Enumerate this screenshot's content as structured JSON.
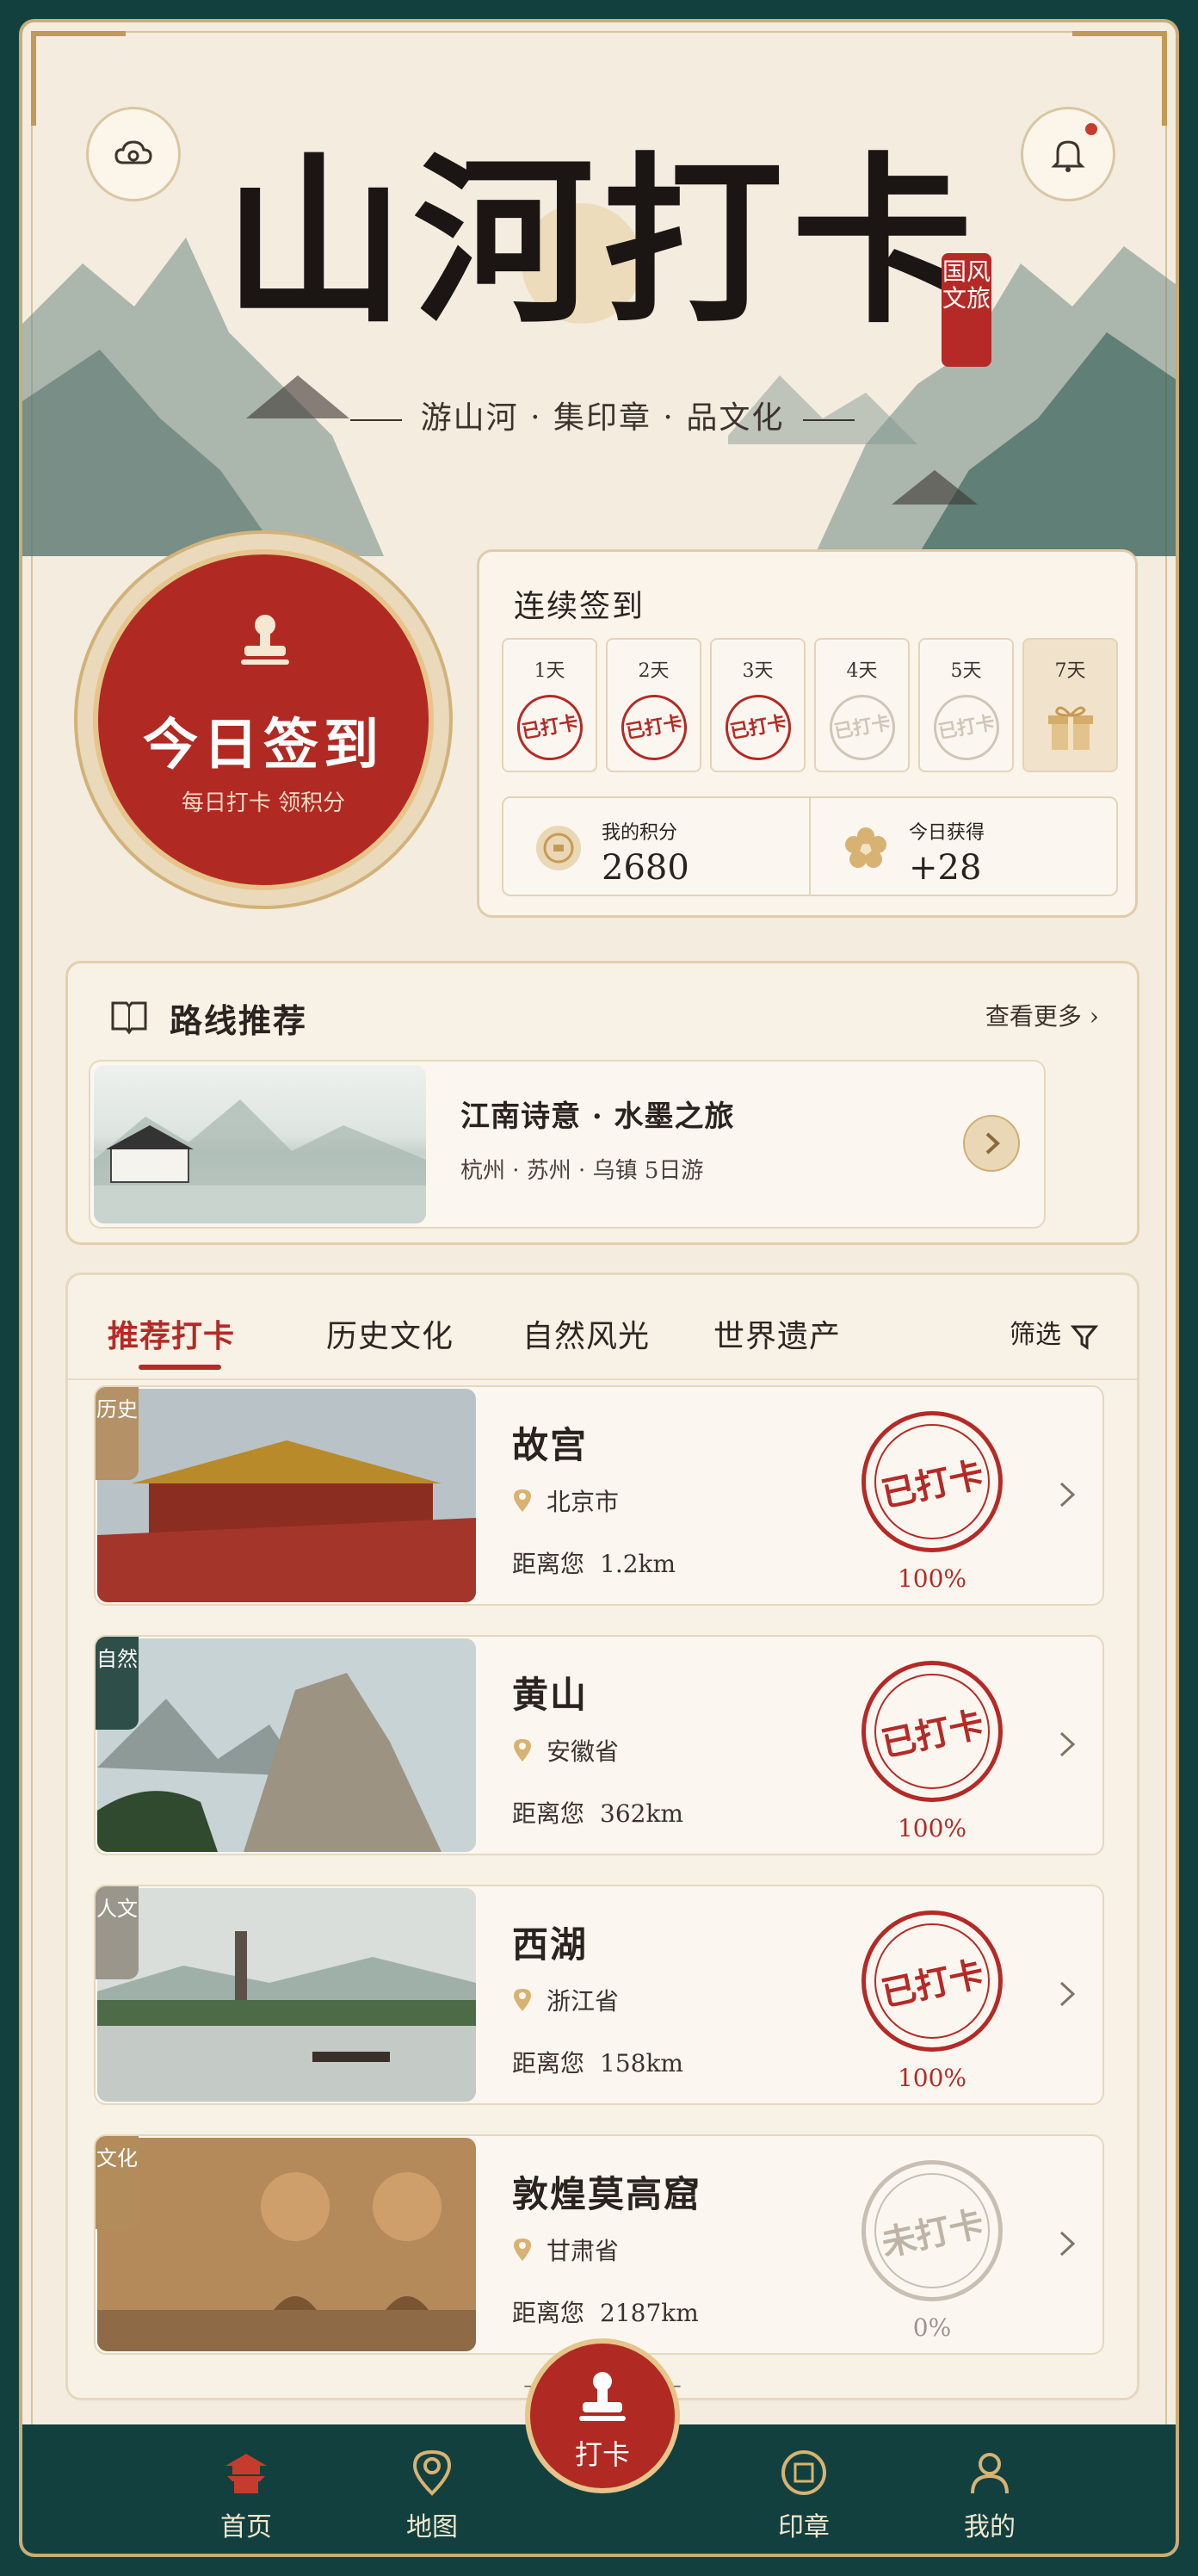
{
  "header": {
    "title": "山河打卡",
    "seal": "国风文旅",
    "subtitle": "游山河 · 集印章 · 品文化"
  },
  "checkin": {
    "button_title": "今日签到",
    "button_sub": "每日打卡 领积分",
    "card_title": "连续签到",
    "days": [
      {
        "label": "1天",
        "stamp": "已打卡"
      },
      {
        "label": "2天",
        "stamp": "已打卡"
      },
      {
        "label": "3天",
        "stamp": "已打卡"
      },
      {
        "label": "4天",
        "stamp": "已打卡"
      },
      {
        "label": "5天",
        "stamp": "已打卡"
      },
      {
        "label": "7天",
        "stamp": ""
      }
    ],
    "points_label": "我的积分",
    "points_value": "2680",
    "today_label": "今日获得",
    "today_value": "+28"
  },
  "routes": {
    "title": "路线推荐",
    "more": "查看更多",
    "card_name": "江南诗意 · 水墨之旅",
    "card_desc": "杭州 · 苏州 · 乌镇   5日游"
  },
  "tabs": [
    "推荐打卡",
    "历史文化",
    "自然风光",
    "世界遗产"
  ],
  "filter": "筛选",
  "items": [
    {
      "tag": "历史",
      "name": "故宫",
      "location": "北京市",
      "dist_label": "距离您",
      "dist": "1.2km",
      "stamp": "已打卡",
      "percent": "100%"
    },
    {
      "tag": "自然",
      "name": "黄山",
      "location": "安徽省",
      "dist_label": "距离您",
      "dist": "362km",
      "stamp": "已打卡",
      "percent": "100%"
    },
    {
      "tag": "人文",
      "name": "西湖",
      "location": "浙江省",
      "dist_label": "距离您",
      "dist": "158km",
      "stamp": "已打卡",
      "percent": "100%"
    },
    {
      "tag": "文化",
      "name": "敦煌莫高窟",
      "location": "甘肃省",
      "dist_label": "距离您",
      "dist": "2187km",
      "stamp": "未打卡",
      "percent": "0%"
    }
  ],
  "no_more": "— 没有更多了 —",
  "nav": {
    "home": "首页",
    "map": "地图",
    "checkin": "打卡",
    "seal": "印章",
    "mine": "我的"
  },
  "colors": {
    "accent_red": "#b52a26",
    "frame_teal": "#12403f",
    "gold": "#c29a55",
    "paper": "#f4ecdf"
  },
  "icons": [
    "cloud-icon",
    "bell-icon",
    "stamp-icon",
    "gift-icon",
    "coin-icon",
    "flower-icon",
    "book-icon",
    "chevron-right-icon",
    "filter-icon",
    "location-pin-icon",
    "pagoda-icon",
    "map-icon",
    "user-icon"
  ]
}
